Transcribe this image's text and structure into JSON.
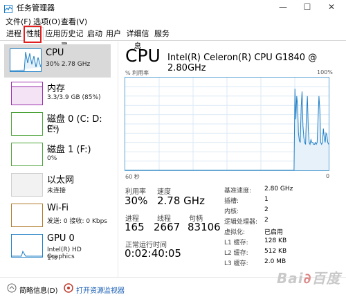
{
  "window": {
    "title": "任务管理器",
    "minimize": "—",
    "maximize": "☐",
    "close": "✕"
  },
  "menu": [
    "文件(F)",
    "选项(O)",
    "查看(V)"
  ],
  "tabs": [
    "进程",
    "性能",
    "应用历史记录",
    "启动",
    "用户",
    "详细信息",
    "服务"
  ],
  "active_tab": "性能",
  "sidebar": {
    "items": [
      {
        "title": "CPU",
        "sub": "30% 2.78 GHz",
        "color": "#1f7fc6"
      },
      {
        "title": "内存",
        "sub": "3.3/3.9 GB (85%)",
        "color": "#9b2fae"
      },
      {
        "title": "磁盘 0 (C: D: E:)",
        "sub": "0%",
        "color": "#4ca33a"
      },
      {
        "title": "磁盘 1 (F:)",
        "sub": "0%",
        "color": "#4ca33a"
      },
      {
        "title": "以太网",
        "sub": "未连接",
        "color": "#cfcfcf"
      },
      {
        "title": "Wi-Fi",
        "sub": "发送: 0 接收: 0 Kbps",
        "color": "#b07a2a"
      },
      {
        "title": "GPU 0",
        "sub": "Intel(R) HD Graphics",
        "sub2": "1%",
        "color": "#1f7fc6"
      }
    ]
  },
  "main": {
    "title": "CPU",
    "processor": "Intel(R) Celeron(R) CPU G1840 @ 2.80GHz",
    "graph_label": "% 利用率",
    "graph_max": "100%",
    "graph_time": "60 秒",
    "graph_min": "0",
    "stats": {
      "util_label": "利用率",
      "util_value": "30%",
      "speed_label": "速度",
      "speed_value": "2.78 GHz",
      "proc_label": "进程",
      "proc_value": "165",
      "thread_label": "线程",
      "thread_value": "2667",
      "handle_label": "句柄",
      "handle_value": "83106",
      "uptime_label": "正常运行时间",
      "uptime_value": "0:02:40:05"
    },
    "details": [
      {
        "k": "基准速度:",
        "v": "2.80 GHz"
      },
      {
        "k": "插槽:",
        "v": "1"
      },
      {
        "k": "内核:",
        "v": "2"
      },
      {
        "k": "逻辑处理器:",
        "v": "2"
      },
      {
        "k": "虚拟化:",
        "v": "已启用"
      },
      {
        "k": "L1 缓存:",
        "v": "128 KB"
      },
      {
        "k": "L2 缓存:",
        "v": "512 KB"
      },
      {
        "k": "L3 缓存:",
        "v": "2.0 MB"
      }
    ]
  },
  "bottom": {
    "summary": "简略信息(D)",
    "monitor": "打开资源监视器"
  },
  "cpu_history": [
    0,
    0,
    0,
    0,
    0,
    0,
    0,
    0,
    0,
    0,
    0,
    0,
    0,
    0,
    0,
    0,
    0,
    0,
    0,
    0,
    0,
    0,
    0,
    0,
    0,
    0,
    0,
    0,
    0,
    0,
    0,
    0,
    0,
    0,
    0,
    0,
    0,
    0,
    0,
    0,
    0,
    0,
    0,
    0,
    0,
    0,
    0,
    0,
    0,
    0,
    0,
    0,
    0,
    0,
    0,
    0,
    0,
    0,
    0,
    0,
    0,
    0,
    0,
    0,
    0,
    0,
    0,
    0,
    0,
    0,
    0,
    0,
    0,
    0,
    0,
    0,
    0,
    0,
    0,
    0,
    0,
    0,
    0,
    0,
    0,
    0,
    0,
    0,
    0,
    0,
    0,
    0,
    0,
    0,
    0,
    0,
    0,
    0,
    0,
    0,
    0,
    0,
    0,
    0,
    0,
    0,
    0,
    0,
    0,
    0,
    0,
    0,
    0,
    0,
    0,
    0,
    0,
    0,
    0,
    0,
    0,
    0,
    0,
    0,
    0,
    0,
    0,
    0,
    0,
    0,
    0,
    0,
    0,
    0,
    0,
    0,
    0,
    0,
    0,
    0,
    0,
    0,
    0,
    0,
    0,
    0,
    0,
    0,
    0,
    0,
    0,
    0,
    0,
    0,
    0,
    0,
    0,
    0,
    0,
    0,
    0,
    0,
    0,
    0,
    0,
    0,
    0,
    0,
    0,
    0,
    0,
    0,
    0,
    0,
    0,
    0,
    0,
    0,
    0,
    0,
    0,
    0,
    0,
    0,
    0,
    0,
    0,
    0,
    0,
    0,
    0,
    88,
    55,
    80,
    70,
    40,
    32,
    30,
    68,
    85,
    48,
    35,
    30,
    28,
    62,
    80,
    45,
    30,
    28,
    33,
    30,
    30,
    28,
    28,
    30,
    28,
    30,
    55,
    80,
    65,
    30,
    28,
    30,
    45,
    35,
    30,
    40,
    38,
    30,
    28
  ]
}
